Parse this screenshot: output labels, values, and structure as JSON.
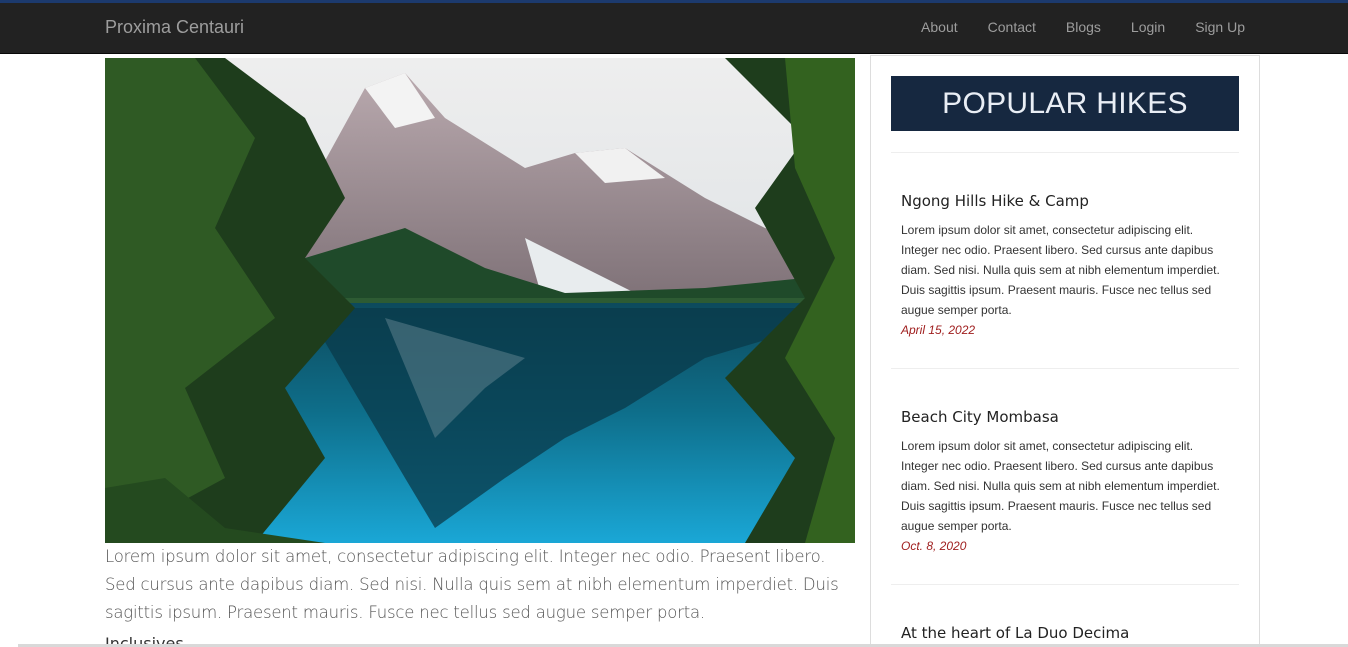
{
  "navbar": {
    "brand": "Proxima Centauri",
    "links": [
      "About",
      "Contact",
      "Blogs",
      "Login",
      "Sign Up"
    ]
  },
  "main": {
    "image_alt": "Mountain lake with reflections framed by pine trees",
    "paragraph": "Lorem ipsum dolor sit amet, consectetur adipiscing elit. Integer nec odio. Praesent libero. Sed cursus ante dapibus diam. Sed nisi. Nulla quis sem at nibh elementum imperdiet. Duis sagittis ipsum. Praesent mauris. Fusce nec tellus sed augue semper porta.",
    "subheading": "Inclusives"
  },
  "sidebar": {
    "title": "POPULAR HIKES",
    "hikes": [
      {
        "title": "Ngong Hills Hike & Camp",
        "description": "Lorem ipsum dolor sit amet, consectetur adipiscing elit. Integer nec odio. Praesent libero. Sed cursus ante dapibus diam. Sed nisi. Nulla quis sem at nibh elementum imperdiet. Duis sagittis ipsum. Praesent mauris. Fusce nec tellus sed augue semper porta.",
        "date": "April 15, 2022"
      },
      {
        "title": "Beach City Mombasa",
        "description": "Lorem ipsum dolor sit amet, consectetur adipiscing elit. Integer nec odio. Praesent libero. Sed cursus ante dapibus diam. Sed nisi. Nulla quis sem at nibh elementum imperdiet. Duis sagittis ipsum. Praesent mauris. Fusce nec tellus sed augue semper porta.",
        "date": "Oct. 8, 2020"
      },
      {
        "title": "At the heart of La Duo Decima",
        "description": "",
        "date": ""
      }
    ]
  },
  "colors": {
    "navbar_bg": "#222222",
    "navbar_accent": "#1c3a6e",
    "sidebar_title_bg": "#162840",
    "date_color": "#a02020"
  }
}
